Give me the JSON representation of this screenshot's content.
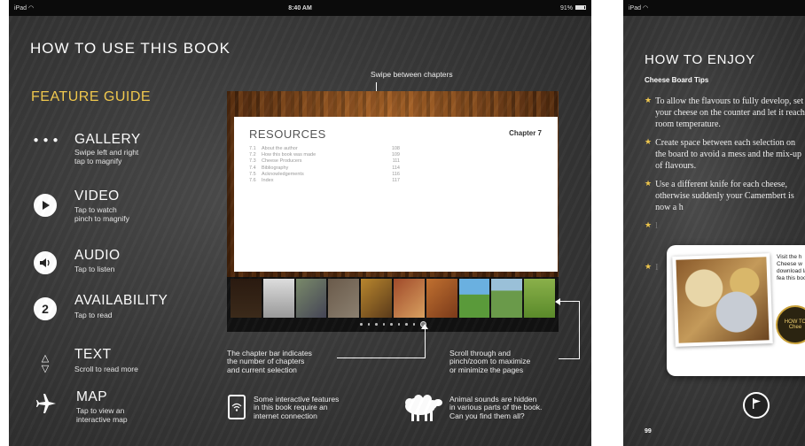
{
  "left": {
    "status": {
      "carrier": "iPad",
      "time": "8:40 AM",
      "battery": "91%"
    },
    "title": "HOW TO USE THIS BOOK",
    "guide_title": "FEATURE GUIDE",
    "features": [
      {
        "title": "GALLERY",
        "sub1": "Swipe left and right",
        "sub2": "tap to magnify",
        "icon": "dots-icon"
      },
      {
        "title": "VIDEO",
        "sub1": "Tap to watch",
        "sub2": "pinch to magnify",
        "icon": "play-icon"
      },
      {
        "title": "AUDIO",
        "sub1": "Tap to listen",
        "sub2": "",
        "icon": "speaker-icon"
      },
      {
        "title": "AVAILABILITY",
        "sub1": "Tap to read",
        "sub2": "",
        "icon": "number-2-icon",
        "glyph": "2"
      },
      {
        "title": "TEXT",
        "sub1": "Scroll to read more",
        "sub2": "",
        "icon": "up-down-arrows-icon"
      },
      {
        "title": "MAP",
        "sub1": "Tap to view an",
        "sub2": "interactive map",
        "icon": "airplane-icon"
      }
    ],
    "preview": {
      "page_title": "RESOURCES",
      "chapter": "Chapter 7",
      "toc": [
        {
          "n": "7.1",
          "t": "About the author",
          "p": "108"
        },
        {
          "n": "7.2",
          "t": "How this book was made",
          "p": "109"
        },
        {
          "n": "7.3",
          "t": "Cheese Producers",
          "p": "111"
        },
        {
          "n": "7.4",
          "t": "Bibliography",
          "p": "114"
        },
        {
          "n": "7.5",
          "t": "Acknowledgements",
          "p": "116"
        },
        {
          "n": "7.6",
          "t": "Index",
          "p": "117"
        }
      ]
    },
    "annotations": {
      "swipe": "Swipe between chapters",
      "chapter_bar_1": "The chapter bar indicates",
      "chapter_bar_2": "the number of chapters",
      "chapter_bar_3": "and current selection",
      "scroll_1": "Scroll through and",
      "scroll_2": "pinch/zoom to maximize",
      "scroll_3": "or minimize the pages",
      "internet_1": "Some interactive features",
      "internet_2": "in this book require an",
      "internet_3": "internet connection",
      "animal_1": "Animal sounds are hidden",
      "animal_2": "in various parts of the book.",
      "animal_3": "Can you find them all?"
    }
  },
  "right": {
    "status": {
      "carrier": "iPad"
    },
    "title": "HOW TO ENJOY",
    "subtitle": "Cheese Board Tips",
    "tips": [
      "To allow the flavours to fully develop, set your cheese on the counter and let it reach room temperature.",
      "Create space between each selection on the board to avoid a mess and the mix-up of flavours.",
      "Use a different knife for each cheese, otherwise suddenly your Camembert is now a h"
    ],
    "popup_text": "Visit the h Cheese w download labels fea this book",
    "badge_text": "HOW TO Chee",
    "page_number": "99"
  },
  "colors": {
    "accent": "#f2c94c",
    "chalkboard": "#3a3a3a"
  }
}
